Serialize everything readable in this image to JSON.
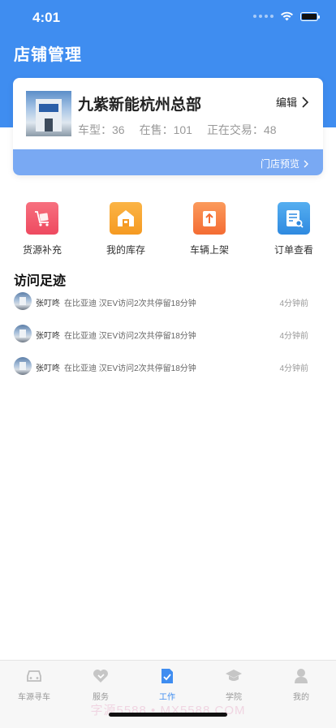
{
  "status_bar": {
    "time": "4:01"
  },
  "page": {
    "title": "店铺管理"
  },
  "store": {
    "name": "九紫新能杭州总部",
    "edit_label": "编辑",
    "stats": {
      "car_types": "车型：36",
      "on_sale": "在售：101",
      "trading": "正在交易：48"
    },
    "preview_label": "门店预览"
  },
  "quick_menu": [
    {
      "label": "货源补充",
      "icon": "cart-icon",
      "color": "#f0566a"
    },
    {
      "label": "我的库存",
      "icon": "warehouse-icon",
      "color": "#f7a230"
    },
    {
      "label": "车辆上架",
      "icon": "upload-icon",
      "color": "#f77a3c"
    },
    {
      "label": "订单查看",
      "icon": "order-search-icon",
      "color": "#3d98e8"
    }
  ],
  "visits": {
    "title": "访问足迹",
    "items": [
      {
        "name": "张叮咚",
        "desc": "在比亚迪 汉EV访问2次共停留18分钟",
        "time": "4分钟前"
      },
      {
        "name": "张叮咚",
        "desc": "在比亚迪 汉EV访问2次共停留18分钟",
        "time": "4分钟前"
      },
      {
        "name": "张叮咚",
        "desc": "在比亚迪 汉EV访问2次共停留18分钟",
        "time": "4分钟前"
      }
    ]
  },
  "tabs": [
    {
      "label": "车源寻车",
      "icon": "car-icon"
    },
    {
      "label": "服务",
      "icon": "service-icon"
    },
    {
      "label": "工作",
      "icon": "work-icon",
      "active": true
    },
    {
      "label": "学院",
      "icon": "graduation-cap-icon"
    },
    {
      "label": "我的",
      "icon": "user-icon"
    }
  ],
  "watermark": "字源5588 • MX5588.COM",
  "colors": {
    "brand_blue": "#3f8df0",
    "preview_blue": "#79a9f3"
  }
}
